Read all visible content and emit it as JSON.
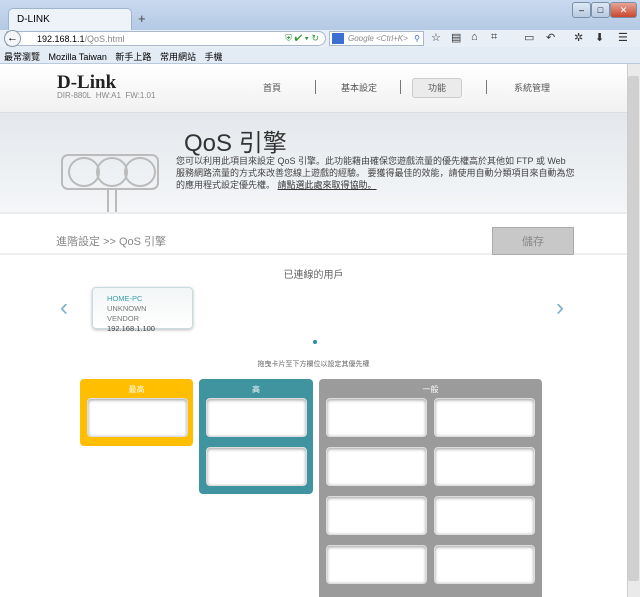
{
  "browser": {
    "tab_title": "D-LINK",
    "new_tab": "+",
    "url_host": "192.168.1.1",
    "url_path": "/QoS.html",
    "search_placeholder": "Google <Ctrl+K>",
    "bookmarks": [
      "最常瀏覽",
      "Mozilla Taiwan",
      "新手上路",
      "常用網站",
      "手機"
    ]
  },
  "header": {
    "logo": "D-Link",
    "model": "DIR-880L",
    "hw": "HW:A1",
    "fw": "FW:1.01",
    "menu": [
      "首頁",
      "基本設定",
      "功能",
      "系統管理"
    ],
    "active_menu": "功能"
  },
  "banner": {
    "title": "QoS 引擎",
    "description": "您可以利用此項目來設定 QoS 引擎。此功能藉由確保您遊戲流量的優先權高於其他如 FTP 或 Web 服務網路流量的方式來改善您線上遊戲的經驗。 要獲得最佳的效能，請使用自動分類項目來自動為您的應用程式設定優先權。",
    "help_link": "請點選此處來取得協助。"
  },
  "breadcrumb": "進階設定 >> QoS 引擎",
  "save_label": "儲存",
  "clients": {
    "heading": "已連線的用戶",
    "items": [
      {
        "name": "HOME-PC",
        "vendor": "UNKNOWN VENDOR",
        "ip": "192.168.1.100"
      }
    ],
    "hint": "拖曳卡片至下方欄位以設定其優先權"
  },
  "priorities": [
    {
      "label": "最高",
      "color": "#ffbe00",
      "slots": 1
    },
    {
      "label": "高",
      "color": "#40949f",
      "slots": 2
    },
    {
      "label": "一般",
      "color": "#9b9b9b",
      "slots": 8
    }
  ]
}
